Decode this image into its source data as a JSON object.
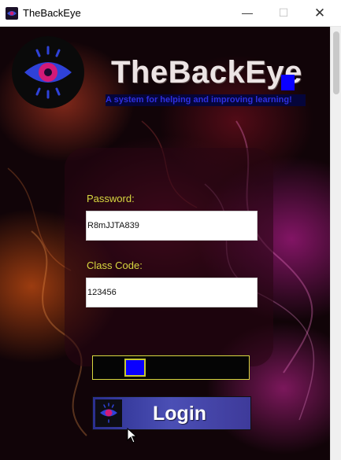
{
  "window": {
    "title": "TheBackEye",
    "controls": {
      "minimize": "—",
      "maximize": "☐",
      "close": "✕"
    }
  },
  "header": {
    "app_name": "TheBackEye",
    "tagline": "A system for helping and improving learning!"
  },
  "form": {
    "password_label": "Password:",
    "password_value": "R8mJJTA839",
    "class_code_label": "Class Code:",
    "class_code_value": "123456"
  },
  "login": {
    "label": "Login"
  },
  "icons": {
    "logo": "eye-icon",
    "login_logo": "eye-icon"
  },
  "colors": {
    "accent_blue": "#0a00ff",
    "label_yellow": "#d8d840",
    "tagline_text": "#2f2fe0",
    "button_blue": "#3e3a9a"
  }
}
